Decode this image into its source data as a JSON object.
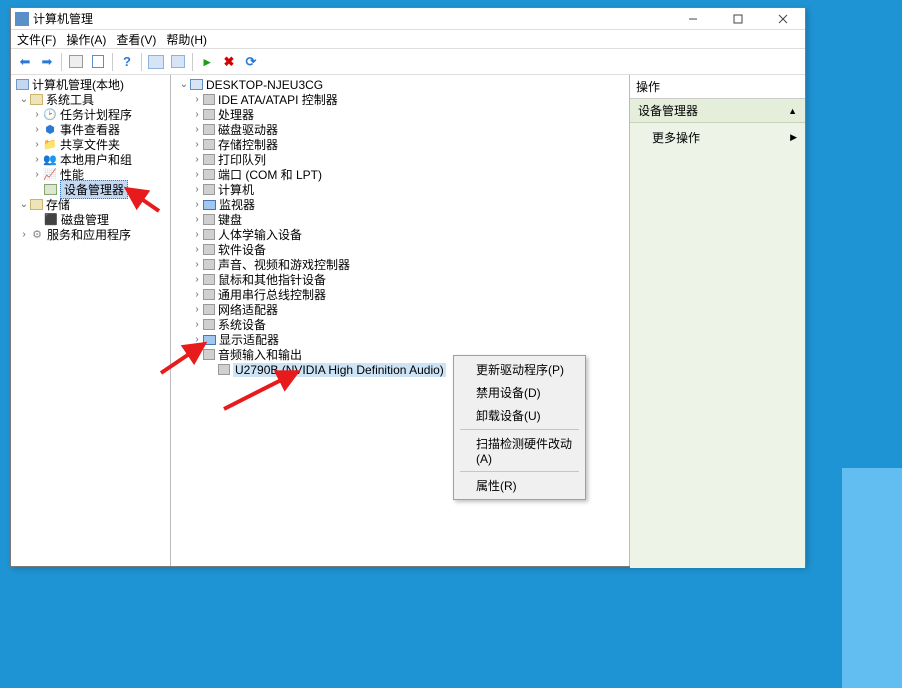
{
  "window": {
    "title": "计算机管理"
  },
  "menubar": {
    "file": "文件(F)",
    "action": "操作(A)",
    "view": "查看(V)",
    "help": "帮助(H)"
  },
  "left_tree": {
    "root": "计算机管理(本地)",
    "system_tools": "系统工具",
    "task_scheduler": "任务计划程序",
    "event_viewer": "事件查看器",
    "shared_folders": "共享文件夹",
    "local_users": "本地用户和组",
    "performance": "性能",
    "device_manager": "设备管理器",
    "storage": "存储",
    "disk_mgmt": "磁盘管理",
    "services_apps": "服务和应用程序"
  },
  "device_tree": {
    "computer_name": "DESKTOP-NJEU3CG",
    "ide": "IDE ATA/ATAPI 控制器",
    "cpu": "处理器",
    "disk_drives": "磁盘驱动器",
    "storage_ctrl": "存储控制器",
    "print_queue": "打印队列",
    "ports": "端口 (COM 和 LPT)",
    "computer": "计算机",
    "monitors": "监视器",
    "keyboards": "键盘",
    "hid": "人体学输入设备",
    "software": "软件设备",
    "sound": "声音、视频和游戏控制器",
    "mice": "鼠标和其他指针设备",
    "usb": "通用串行总线控制器",
    "network": "网络适配器",
    "system": "系统设备",
    "display": "显示适配器",
    "audio_io": "音频输入和输出",
    "audio_device": "U2790B (NVIDIA High Definition Audio)"
  },
  "context_menu": {
    "update_driver": "更新驱动程序(P)",
    "disable": "禁用设备(D)",
    "uninstall": "卸载设备(U)",
    "scan": "扫描检测硬件改动(A)",
    "properties": "属性(R)"
  },
  "actions_pane": {
    "header": "操作",
    "section": "设备管理器",
    "more_actions": "更多操作"
  }
}
